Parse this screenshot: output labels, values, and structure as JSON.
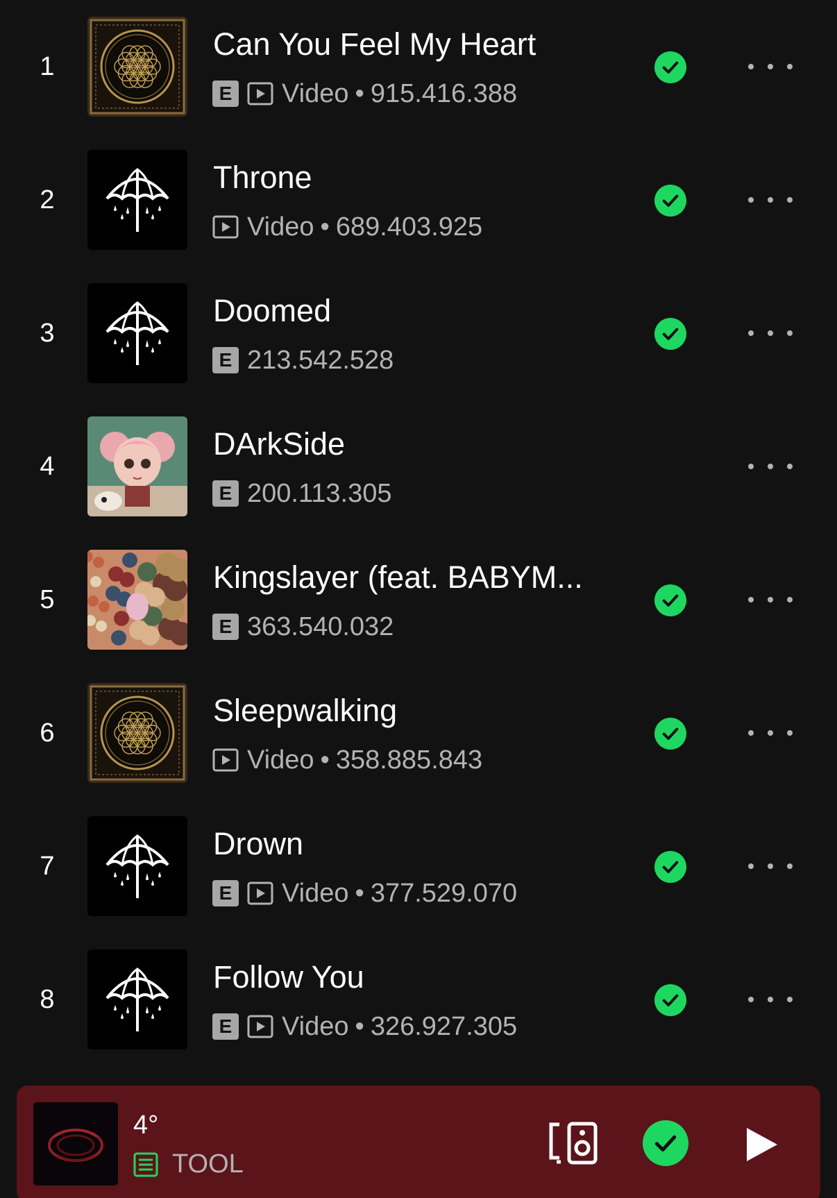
{
  "tracks": [
    {
      "rank": "1",
      "title": "Can You Feel My Heart",
      "explicit": true,
      "video": true,
      "video_label": "Video",
      "plays": "915.416.388",
      "saved": true,
      "art": "flower-of-life-cover"
    },
    {
      "rank": "2",
      "title": "Throne",
      "explicit": false,
      "video": true,
      "video_label": "Video",
      "plays": "689.403.925",
      "saved": true,
      "art": "umbrella-cover"
    },
    {
      "rank": "3",
      "title": "Doomed",
      "explicit": true,
      "video": false,
      "video_label": "",
      "plays": "213.542.528",
      "saved": true,
      "art": "umbrella-cover"
    },
    {
      "rank": "4",
      "title": "DArkSide",
      "explicit": true,
      "video": false,
      "video_label": "",
      "plays": "200.113.305",
      "saved": false,
      "art": "doll-girl-cover"
    },
    {
      "rank": "5",
      "title": "Kingslayer (feat. BABYM...",
      "explicit": true,
      "video": false,
      "video_label": "",
      "plays": "363.540.032",
      "saved": true,
      "art": "crowd-illustration-cover"
    },
    {
      "rank": "6",
      "title": "Sleepwalking",
      "explicit": false,
      "video": true,
      "video_label": "Video",
      "plays": "358.885.843",
      "saved": true,
      "art": "flower-of-life-cover"
    },
    {
      "rank": "7",
      "title": "Drown",
      "explicit": true,
      "video": true,
      "video_label": "Video",
      "plays": "377.529.070",
      "saved": true,
      "art": "umbrella-cover"
    },
    {
      "rank": "8",
      "title": "Follow You",
      "explicit": true,
      "video": true,
      "video_label": "Video",
      "plays": "326.927.305",
      "saved": true,
      "art": "umbrella-cover"
    }
  ],
  "badges": {
    "explicit": "E",
    "separator": "•"
  },
  "now_playing": {
    "title": "4°",
    "artist": "TOOL",
    "saved": true,
    "icons": [
      "queue-icon",
      "connect-device-icon",
      "check-icon",
      "play-icon"
    ]
  },
  "colors": {
    "background": "#121212",
    "accent_green": "#1ed760",
    "player_background": "#5b141a",
    "secondary_text": "#b3b3b3"
  }
}
